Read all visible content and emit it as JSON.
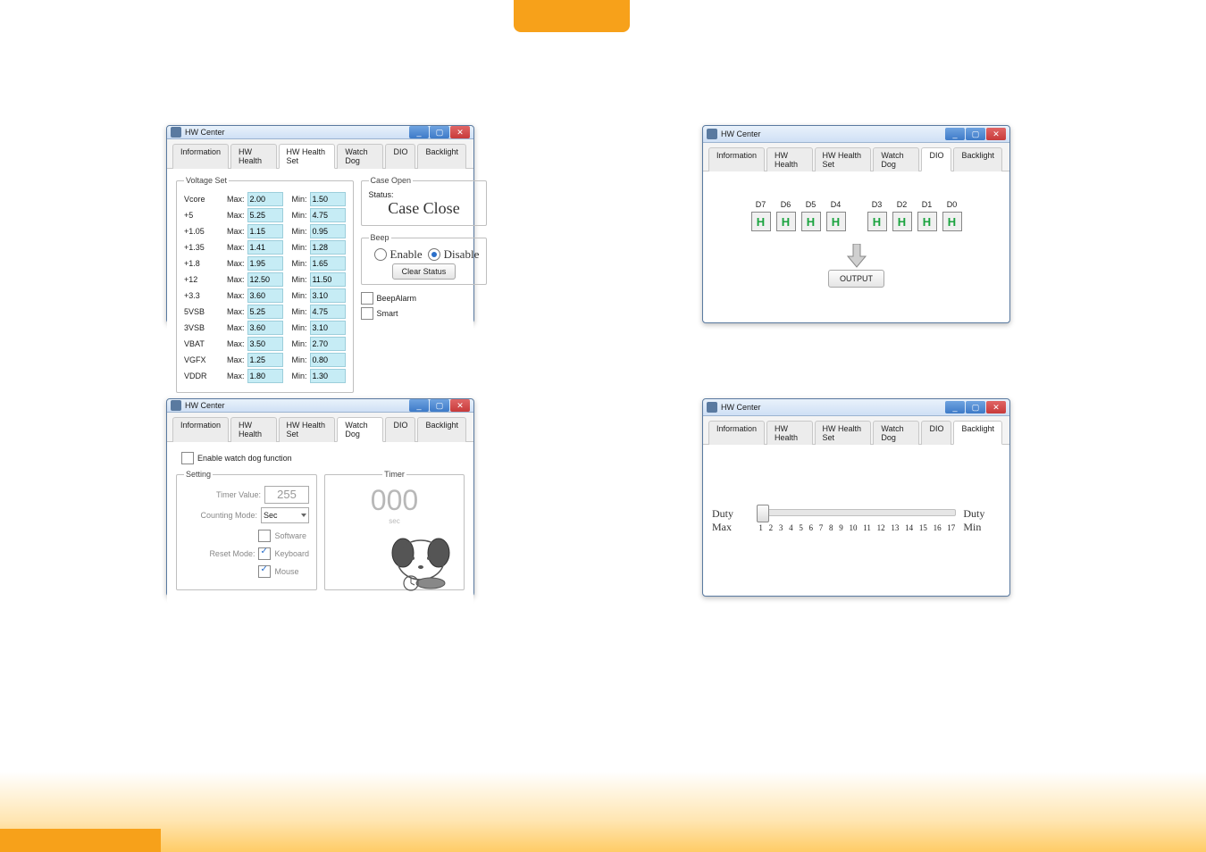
{
  "app_title": "HW Center",
  "tabs": [
    "Information",
    "HW Health",
    "HW Health Set",
    "Watch Dog",
    "DIO",
    "Backlight"
  ],
  "hw_health_set": {
    "voltage_set_legend": "Voltage Set",
    "max_label": "Max:",
    "min_label": "Min:",
    "rails": [
      {
        "name": "Vcore",
        "max": "2.00",
        "min": "1.50"
      },
      {
        "name": "+5",
        "max": "5.25",
        "min": "4.75"
      },
      {
        "name": "+1.05",
        "max": "1.15",
        "min": "0.95"
      },
      {
        "name": "+1.35",
        "max": "1.41",
        "min": "1.28"
      },
      {
        "name": "+1.8",
        "max": "1.95",
        "min": "1.65"
      },
      {
        "name": "+12",
        "max": "12.50",
        "min": "11.50"
      },
      {
        "name": "+3.3",
        "max": "3.60",
        "min": "3.10"
      },
      {
        "name": "5VSB",
        "max": "5.25",
        "min": "4.75"
      },
      {
        "name": "3VSB",
        "max": "3.60",
        "min": "3.10"
      },
      {
        "name": "VBAT",
        "max": "3.50",
        "min": "2.70"
      },
      {
        "name": "VGFX",
        "max": "1.25",
        "min": "0.80"
      },
      {
        "name": "VDDR",
        "max": "1.80",
        "min": "1.30"
      }
    ],
    "caseopen_legend": "Case Open",
    "caseopen_status_label": "Status:",
    "caseopen_status_value": "Case Close",
    "beep_legend": "Beep",
    "beep_enable_label": "Enable",
    "beep_disable_label": "Disable",
    "clear_status_button": "Clear Status",
    "beepalarm_label": "BeepAlarm",
    "smart_label": "Smart"
  },
  "dio": {
    "labels": [
      "D7",
      "D6",
      "D5",
      "D4",
      "D3",
      "D2",
      "D1",
      "D0"
    ],
    "values": [
      "H",
      "H",
      "H",
      "H",
      "H",
      "H",
      "H",
      "H"
    ],
    "output_button": "OUTPUT"
  },
  "watchdog": {
    "enable_label": "Enable watch dog function",
    "setting_legend": "Setting",
    "timer_legend": "Timer",
    "timer_value_label": "Timer Value:",
    "timer_value": "255",
    "counting_mode_label": "Counting Mode:",
    "counting_mode_value": "Sec",
    "reset_mode_label": "Reset Mode:",
    "reset_software": "Software",
    "reset_keyboard": "Keyboard",
    "reset_mouse": "Mouse",
    "timer_display": "000",
    "timer_unit": "sec"
  },
  "backlight": {
    "duty_max_label": "Duty Max",
    "duty_min_label": "Duty Min",
    "ticks": [
      "1",
      "2",
      "3",
      "4",
      "5",
      "6",
      "7",
      "8",
      "9",
      "10",
      "11",
      "12",
      "13",
      "14",
      "15",
      "16",
      "17"
    ]
  }
}
